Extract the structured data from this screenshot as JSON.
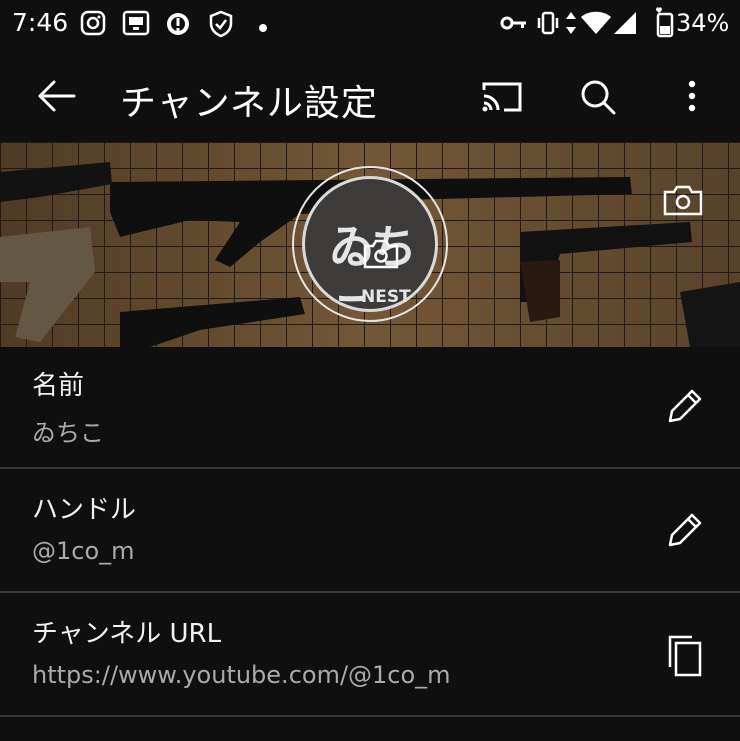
{
  "status_bar": {
    "time": "7:46",
    "battery_percent": "34%",
    "icons": [
      "instagram-icon",
      "cast-screen-icon",
      "alert-gear-icon",
      "shield-icon",
      "dot-icon",
      "key-icon",
      "vibrate-icon",
      "data-arrows-icon",
      "wifi-icon",
      "signal-icon",
      "battery-icon"
    ]
  },
  "app_bar": {
    "title": "チャンネル設定"
  },
  "banner": {
    "avatar_text": "ゐちこ",
    "avatar_subtext": "NEST"
  },
  "rows": [
    {
      "label": "名前",
      "value": "ゐちこ",
      "action_icon": "edit-pencil-icon"
    },
    {
      "label": "ハンドル",
      "value": "@1co_m",
      "action_icon": "edit-pencil-icon"
    },
    {
      "label": "チャンネル URL",
      "value": "https://www.youtube.com/@1co_m",
      "action_icon": "copy-icon"
    }
  ],
  "colors": {
    "background": "#0f0f0f",
    "divider": "#3a3a3a",
    "secondary_text": "#aaaaaa"
  }
}
